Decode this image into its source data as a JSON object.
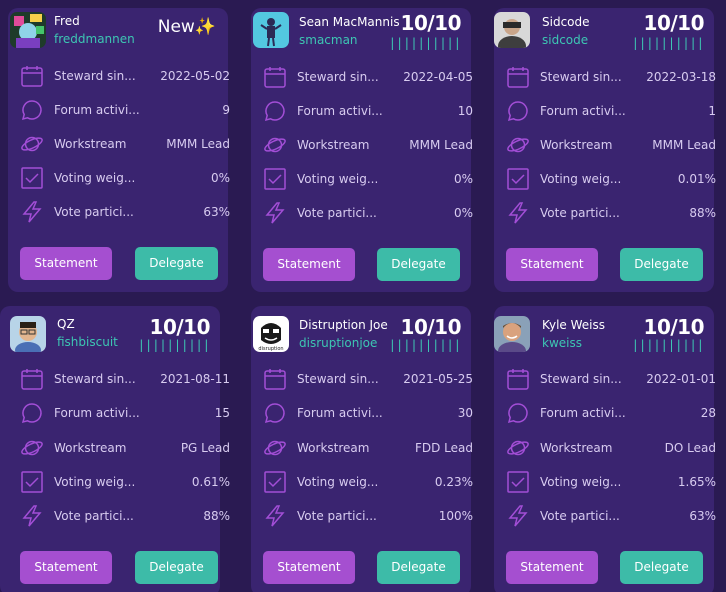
{
  "labels": {
    "steward_since": "Steward sin...",
    "forum_activity": "Forum activi...",
    "workstream": "Workstream",
    "voting_weight": "Voting weig...",
    "vote_participation": "Vote partici...",
    "statement_button": "Statement",
    "delegate_button": "Delegate"
  },
  "colors": {
    "background": "#2a1a52",
    "card": "#3a2470",
    "accent_teal": "#3dc6b3",
    "statement_purple": "#a54fd0",
    "delegate_teal": "#3dbba8",
    "icon_purple": "#a24ed6"
  },
  "icons": [
    "calendar-icon",
    "chat-bubble-icon",
    "planet-icon",
    "checkbox-icon",
    "lightning-icon"
  ],
  "cards": [
    {
      "name": "Fred",
      "handle": "freddmannen",
      "badge": "New✨",
      "steward_since": "2022-05-02",
      "forum_activity": "9",
      "workstream": "MMM Lead",
      "voting_weight": "0%",
      "vote_participation": "63%"
    },
    {
      "name": "Sean MacMannis",
      "handle": "smacman",
      "score": "10/10",
      "bars": "||||||||||",
      "steward_since": "2022-04-05",
      "forum_activity": "10",
      "workstream": "MMM Lead",
      "voting_weight": "0%",
      "vote_participation": "0%"
    },
    {
      "name": "Sidcode",
      "handle": "sidcode",
      "score": "10/10",
      "bars": "||||||||||",
      "steward_since": "2022-03-18",
      "forum_activity": "1",
      "workstream": "MMM Lead",
      "voting_weight": "0.01%",
      "vote_participation": "88%"
    },
    {
      "name": "QZ",
      "handle": "fishbiscuit",
      "score": "10/10",
      "bars": "||||||||||",
      "steward_since": "2021-08-11",
      "forum_activity": "15",
      "workstream": "PG Lead",
      "voting_weight": "0.61%",
      "vote_participation": "88%"
    },
    {
      "name": "Distruption Joe",
      "handle": "disruptionjoe",
      "score": "10/10",
      "bars": "||||||||||",
      "avatar_caption": "disruption",
      "steward_since": "2021-05-25",
      "forum_activity": "30",
      "workstream": "FDD Lead",
      "voting_weight": "0.23%",
      "vote_participation": "100%"
    },
    {
      "name": "Kyle Weiss",
      "handle": "kweiss",
      "score": "10/10",
      "bars": "||||||||||",
      "steward_since": "2022-01-01",
      "forum_activity": "28",
      "workstream": "DO Lead",
      "voting_weight": "1.65%",
      "vote_participation": "63%"
    }
  ]
}
